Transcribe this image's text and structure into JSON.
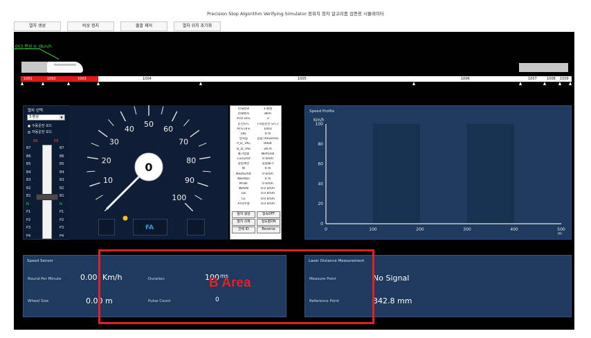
{
  "window": {
    "title": "Precision Stop Algorithm Verifying Simulator 정위치 정차 알고리즘 검증용 시뮬레이터"
  },
  "menu": [
    "열차 생성",
    "비상 정지",
    "출발 제어",
    "열차 위치 초기화"
  ],
  "train_status": "003 편성 V: 0km/h",
  "track": {
    "blocks": [
      "1001",
      "1002",
      "1003",
      "1004",
      "1005",
      "1006",
      "1007",
      "1008",
      "1009"
    ],
    "occupied_blocks": [
      "1001",
      "1002",
      "1003"
    ]
  },
  "lever_panel": {
    "title": "열차 선택",
    "selected_train": "3 편성",
    "modes": [
      {
        "label": "수동운전 모드",
        "selected": false
      },
      {
        "label": "자동운전 모드",
        "selected": true
      }
    ],
    "notches_left": [
      "B7",
      "B6",
      "B5",
      "B4",
      "B3",
      "B2",
      "B1",
      "N",
      "P1",
      "P2",
      "P3",
      "P4"
    ],
    "notches_right": [
      "B7",
      "B6",
      "B5",
      "B4",
      "B3",
      "B2",
      "B1",
      "N",
      "P1",
      "P2",
      "P3",
      "P4"
    ],
    "handle_position": "N",
    "emergency_label": "EB"
  },
  "speedometer": {
    "current_speed": "0",
    "mode_label": "FA",
    "scale_labels": [
      "0",
      "10",
      "20",
      "30",
      "40",
      "50",
      "60",
      "70",
      "80",
      "90",
      "100"
    ],
    "scale_min": 0,
    "scale_max": 100,
    "needle_value": 0
  },
  "info_panel": {
    "rows": [
      {
        "k": "현재정보",
        "v": "3 편성"
      },
      {
        "k": "현재위치",
        "v": "8km"
      },
      {
        "k": "ATO LIFE",
        "v": "3"
      },
      {
        "k": "운전모드",
        "v": "[자동운전 모드]"
      },
      {
        "k": "ATS LIFE",
        "v": "1003"
      },
      {
        "k": "LKE",
        "v": "0 m"
      },
      {
        "k": "정차중",
        "v": "응답 (Reverse)"
      },
      {
        "k": "P_D_TAG",
        "v": "0004"
      },
      {
        "k": "D_D_TAG",
        "v": "28 m"
      },
      {
        "k": "출가방향",
        "v": "Nominal"
      },
      {
        "k": "CurLimit",
        "v": "0 km/h"
      },
      {
        "k": "종합제한",
        "v": "종합불가"
      },
      {
        "k": "W",
        "v": "0 m"
      },
      {
        "k": "NextLimit",
        "v": "0 km/h"
      },
      {
        "k": "NextDis",
        "v": "0 m"
      },
      {
        "k": "MTBF",
        "v": "0 km/h"
      },
      {
        "k": "WARN",
        "v": "0.0 km/h"
      },
      {
        "k": "EB",
        "v": "0.0 km/h"
      },
      {
        "k": "CE",
        "v": "0.0 km/h"
      },
      {
        "k": "ATO주행",
        "v": "0.0 km/h"
      }
    ],
    "buttons": [
      "열차 생성",
      "정속OFF",
      "열차 삭제",
      "정도향ON",
      "전체 ID",
      "Reverse"
    ]
  },
  "speed_profile": {
    "title": "Speed Profile"
  },
  "chart_data": {
    "type": "line",
    "title": "Speed Profile",
    "ylabel": "Km/h",
    "xlabel": "m",
    "xlim": [
      0,
      500
    ],
    "ylim": [
      0,
      100
    ],
    "x_ticks": [
      "0",
      "100",
      "200",
      "300",
      "400",
      "500"
    ],
    "y_ticks": [
      "0",
      "20",
      "40",
      "60",
      "80",
      "100"
    ],
    "series": [],
    "grid": false,
    "shaded_bands_x": [
      [
        100,
        200
      ],
      [
        300,
        400
      ]
    ]
  },
  "speed_sensor": {
    "title": "Speed Sensor",
    "rpm_label": "Round Per Minute",
    "rpm_value": "0.00",
    "rpm_unit": "Km/h",
    "wheel_label": "Wheel Size",
    "wheel_value": "0.00",
    "wheel_unit": "m",
    "duration_label": "Duration",
    "duration_value": "100",
    "duration_unit": "ms",
    "pulse_label": "Pulse Count",
    "pulse_value": "0"
  },
  "laser": {
    "title": "Laser Distance Measurement",
    "measure_label": "Measure Point",
    "measure_value": "No Signal",
    "reference_label": "Reference Point",
    "reference_value": "342.8 mm"
  },
  "annotation": {
    "text": "B Area",
    "color": "#e42020"
  }
}
